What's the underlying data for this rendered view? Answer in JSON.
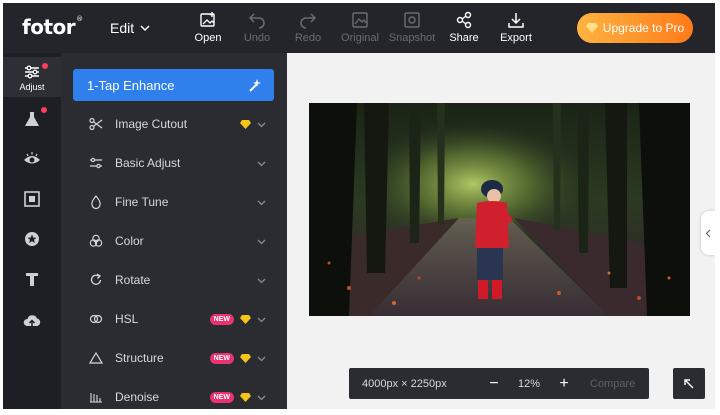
{
  "app": {
    "logo": "fotor",
    "logo_mark": "®",
    "edit_label": "Edit"
  },
  "toolbar": [
    {
      "label": "Open",
      "icon": "image-plus-icon",
      "enabled": true
    },
    {
      "label": "Undo",
      "icon": "undo-icon",
      "enabled": false
    },
    {
      "label": "Redo",
      "icon": "redo-icon",
      "enabled": false
    },
    {
      "label": "Original",
      "icon": "image-icon",
      "enabled": false
    },
    {
      "label": "Snapshot",
      "icon": "snapshot-icon",
      "enabled": false
    },
    {
      "label": "Share",
      "icon": "share-icon",
      "enabled": true
    },
    {
      "label": "Export",
      "icon": "download-icon",
      "enabled": true
    }
  ],
  "upgrade": {
    "label": "Upgrade to Pro",
    "icon": "diamond-icon"
  },
  "rail": {
    "active_label": "Adjust",
    "items": [
      "adjust-icon",
      "beaker-icon",
      "eye-icon",
      "frame-icon",
      "sticker-icon",
      "text-icon",
      "cloud-upload-icon"
    ]
  },
  "panel": {
    "enhance_label": "1-Tap Enhance",
    "items": [
      {
        "label": "Image Cutout",
        "icon": "scissors-icon",
        "new": false,
        "premium": true
      },
      {
        "label": "Basic Adjust",
        "icon": "sliders-icon",
        "new": false,
        "premium": false
      },
      {
        "label": "Fine Tune",
        "icon": "droplet-icon",
        "new": false,
        "premium": false
      },
      {
        "label": "Color",
        "icon": "color-circles-icon",
        "new": false,
        "premium": false
      },
      {
        "label": "Rotate",
        "icon": "rotate-icon",
        "new": false,
        "premium": false
      },
      {
        "label": "HSL",
        "icon": "hsl-icon",
        "new": true,
        "premium": true
      },
      {
        "label": "Structure",
        "icon": "triangle-icon",
        "new": true,
        "premium": true
      },
      {
        "label": "Denoise",
        "icon": "denoise-icon",
        "new": true,
        "premium": true
      }
    ],
    "new_badge": "NEW"
  },
  "zoom": {
    "dimensions": "4000px × 2250px",
    "percent": "12%",
    "minus": "−",
    "plus": "+",
    "compare": "Compare"
  },
  "colors": {
    "topbar": "#24252a",
    "panel": "#2b2c31",
    "accent": "#2f80ed",
    "upgrade": "#ff9a2e",
    "badge": "#e8336f",
    "gem": "#f5c518"
  }
}
